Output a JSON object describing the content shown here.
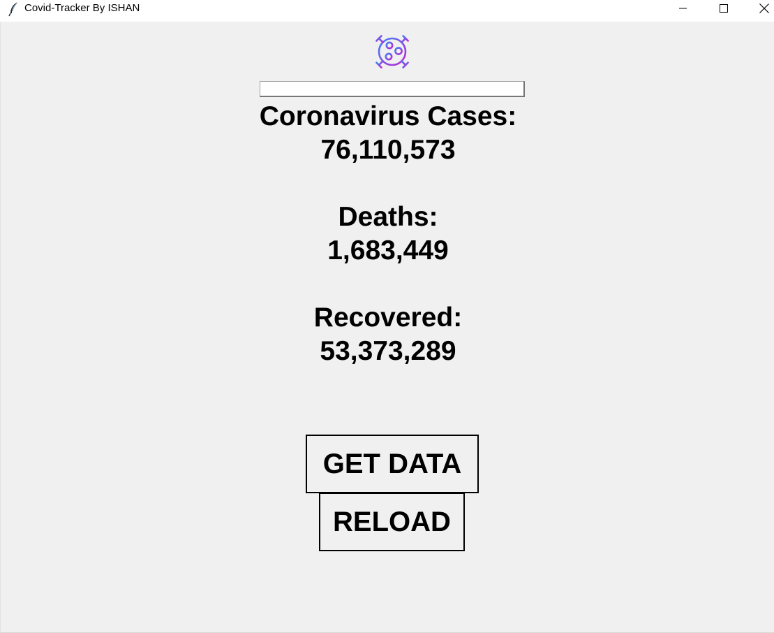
{
  "window": {
    "title": "Covid-Tracker By ISHAN",
    "app_icon": "feather-icon",
    "controls": [
      "minimize-icon",
      "maximize-icon",
      "close-icon"
    ]
  },
  "logo": {
    "icon": "virus-icon",
    "gradient": [
      "#3b82f6",
      "#c026d3"
    ]
  },
  "search": {
    "value": "",
    "placeholder": ""
  },
  "stats": {
    "cases_label": "Coronavirus Cases:",
    "cases_value": "76,110,573",
    "deaths_label": "Deaths:",
    "deaths_value": "1,683,449",
    "recovered_label": "Recovered:",
    "recovered_value": "53,373,289"
  },
  "buttons": {
    "get_data": "GET DATA",
    "reload": "RELOAD"
  },
  "colors": {
    "background": "#f0f0f0",
    "text": "#000000"
  }
}
